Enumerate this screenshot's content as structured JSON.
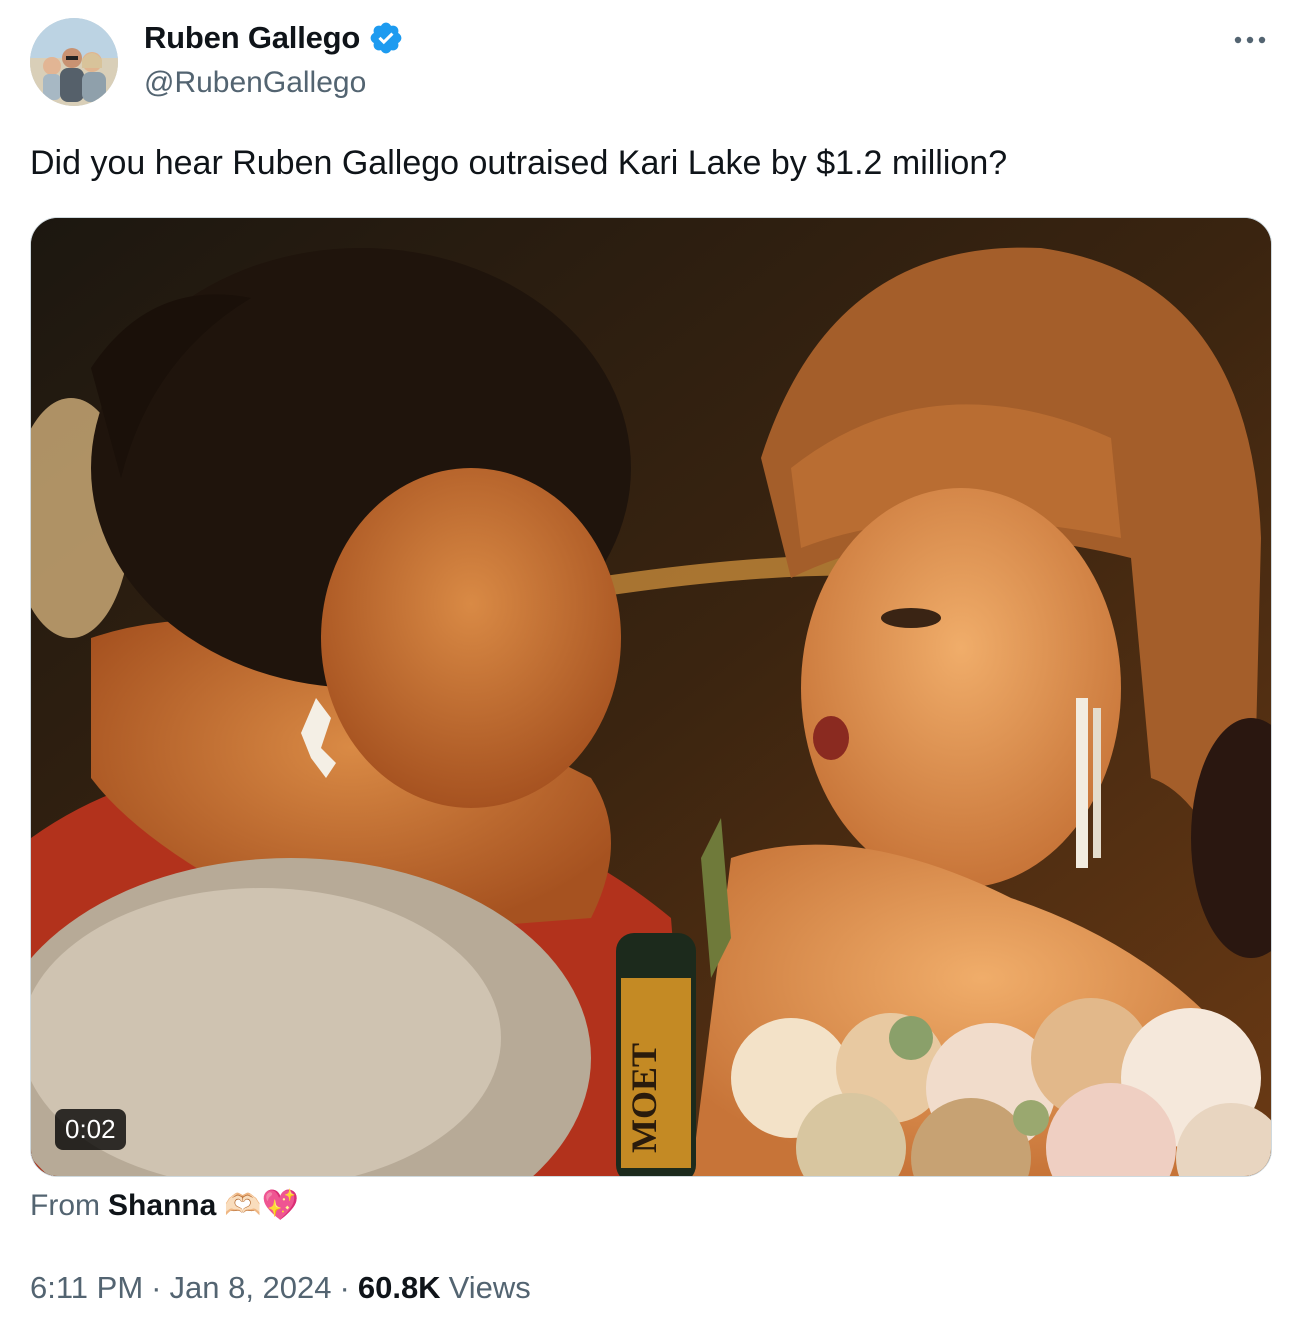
{
  "author": {
    "display_name": "Ruben Gallego",
    "handle": "@RubenGallego",
    "verified": true,
    "verified_color": "#1d9bf0"
  },
  "more_icon": "more-horizontal-icon",
  "tweet": {
    "text": "Did you hear Ruben Gallego outraised Kari Lake by $1.2 million?"
  },
  "media": {
    "type": "video",
    "duration": "0:02",
    "bottle_label": "MOET"
  },
  "attribution": {
    "prefix": "From",
    "name": "Shanna",
    "emoji": "🫶🏻💖"
  },
  "meta": {
    "time": "6:11 PM",
    "separator": "·",
    "date": "Jan 8, 2024",
    "views_count": "60.8K",
    "views_label": "Views"
  },
  "colors": {
    "text_primary": "#0f1419",
    "text_secondary": "#536471",
    "border": "#cfd9de"
  }
}
